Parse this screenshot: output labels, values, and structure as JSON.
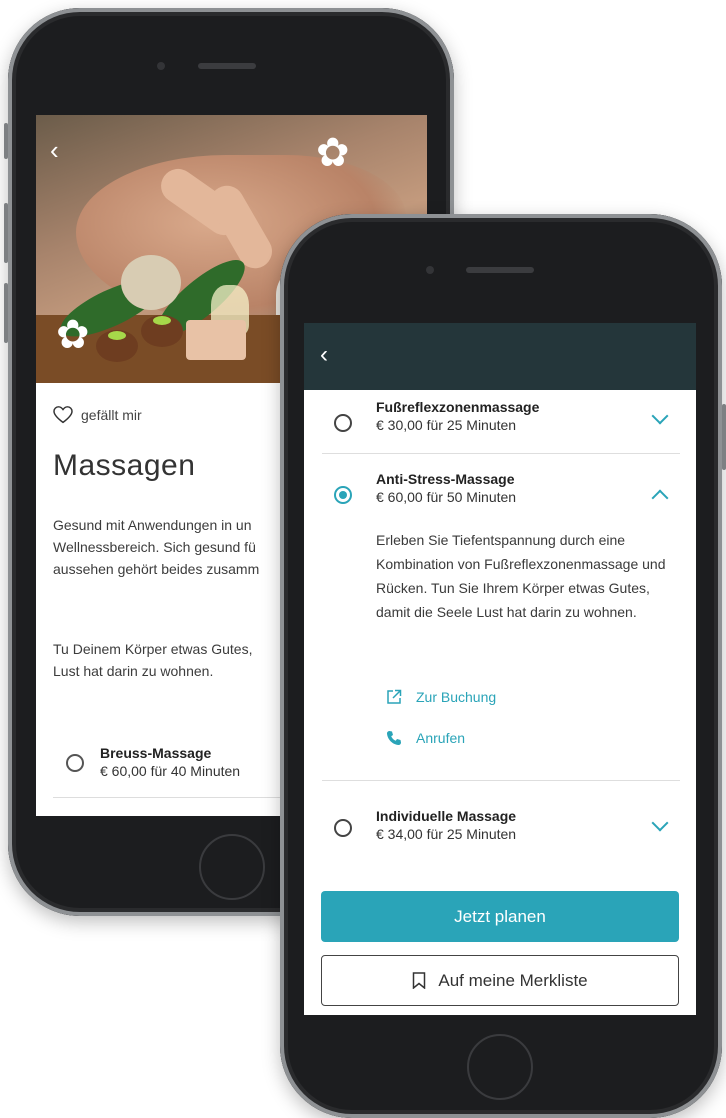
{
  "back_screen": {
    "like_label": "gefällt mir",
    "title": "Massagen",
    "description_lines": [
      "Gesund mit Anwendungen in un",
      "Wellnessbereich. Sich gesund fü",
      "aussehen gehört beides zusamm"
    ],
    "description2_lines": [
      "Tu Deinem Körper etwas Gutes, ",
      "Lust hat darin zu wohnen."
    ],
    "option": {
      "name": "Breuss-Massage",
      "price": "€ 60,00 für 40 Minuten",
      "selected": false
    }
  },
  "front_screen": {
    "header_bg": "#24363a",
    "accent": "#2aa4b8",
    "options": [
      {
        "name": "Fußreflexzonenmassage",
        "price": "€ 30,00 für 25 Minuten",
        "selected": false,
        "expanded": false
      },
      {
        "name": "Anti-Stress-Massage",
        "price": "€ 60,00 für 50 Minuten",
        "selected": true,
        "expanded": true
      },
      {
        "name": "Individuelle Massage",
        "price": "€ 34,00 für 25 Minuten",
        "selected": false,
        "expanded": false
      }
    ],
    "expanded_description": "Erleben Sie Tiefentspannung durch eine Kombination von Fußreflexzonenmassage und Rücken. Tun Sie Ihrem Körper etwas Gutes, damit die Seele Lust hat darin zu wohnen.",
    "actions": {
      "booking_label": "Zur Buchung",
      "booking_icon": "external-link-icon",
      "call_label": "Anrufen",
      "call_icon": "phone-icon"
    },
    "primary_button": "Jetzt planen",
    "secondary_button": "Auf meine Merkliste",
    "secondary_icon": "bookmark-icon"
  }
}
